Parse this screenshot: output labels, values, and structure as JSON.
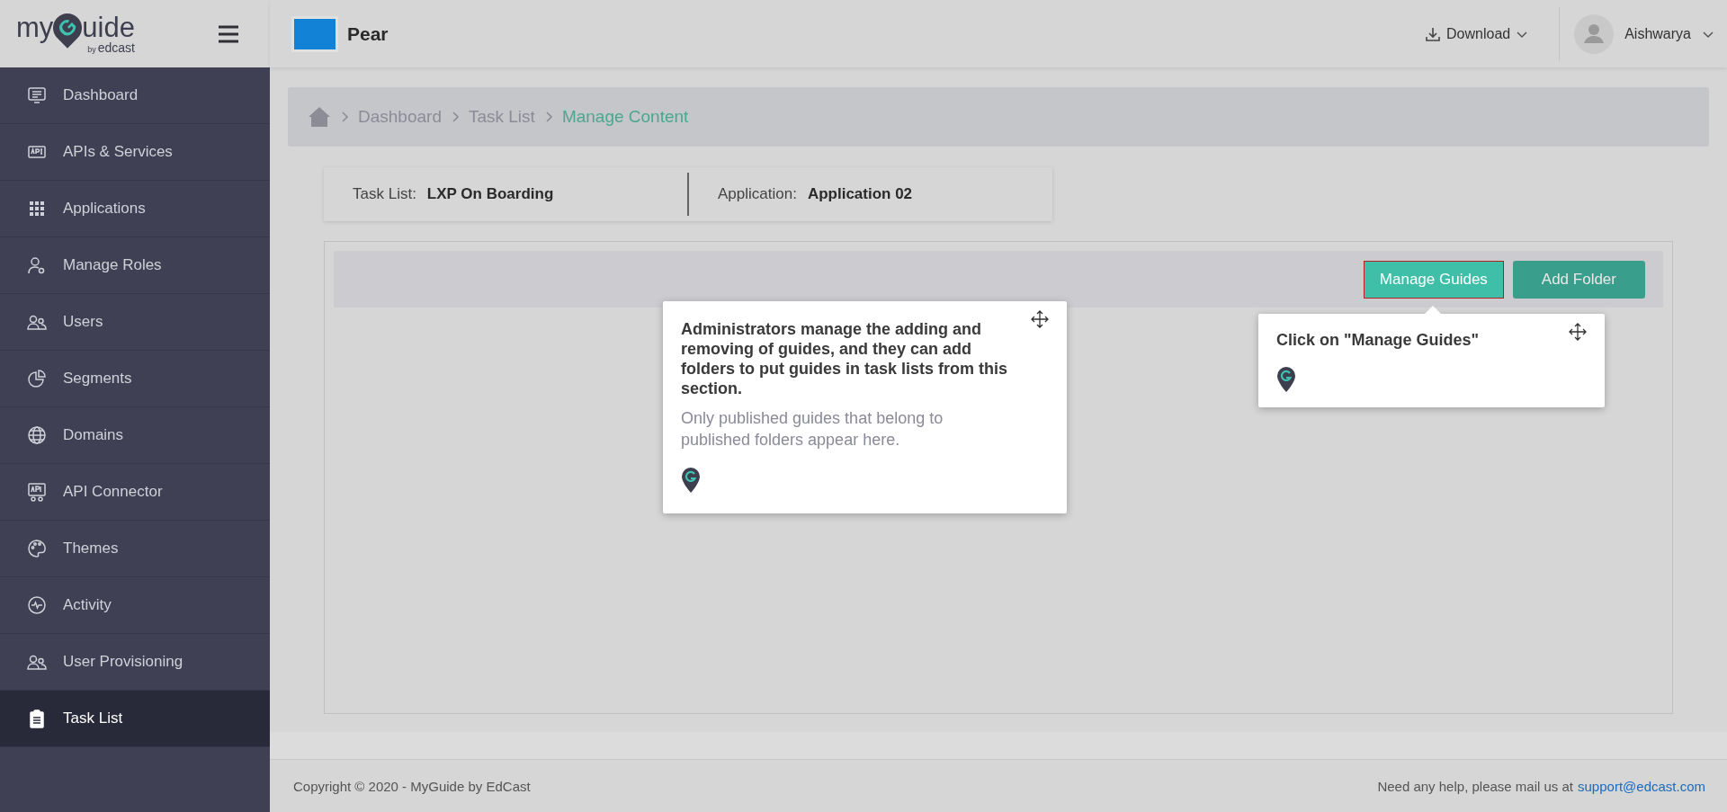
{
  "brand": {
    "prefix": "my",
    "mark": "G",
    "suffix": "uide",
    "byline": "by",
    "company": "edcast"
  },
  "header": {
    "app_name": "Pear",
    "download": "Download",
    "user": "Aishwarya"
  },
  "sidebar": {
    "items": [
      {
        "label": "Dashboard",
        "selected": false
      },
      {
        "label": "APIs & Services",
        "selected": false
      },
      {
        "label": "Applications",
        "selected": false
      },
      {
        "label": "Manage Roles",
        "selected": false
      },
      {
        "label": "Users",
        "selected": false
      },
      {
        "label": "Segments",
        "selected": false
      },
      {
        "label": "Domains",
        "selected": false
      },
      {
        "label": "API Connector",
        "selected": false
      },
      {
        "label": "Themes",
        "selected": false
      },
      {
        "label": "Activity",
        "selected": false
      },
      {
        "label": "User Provisioning",
        "selected": false
      },
      {
        "label": "Task List",
        "selected": true
      }
    ]
  },
  "breadcrumb": [
    {
      "label": "Dashboard",
      "current": false
    },
    {
      "label": "Task List",
      "current": false
    },
    {
      "label": "Manage Content",
      "current": true
    }
  ],
  "info": {
    "task_list_label": "Task List:",
    "task_list_value": "LXP On Boarding",
    "application_label": "Application:",
    "application_value": "Application 02"
  },
  "toolbar": {
    "buttons": [
      {
        "label": "Manage Guides",
        "highlighted": true
      },
      {
        "label": "Add Folder",
        "highlighted": false
      }
    ]
  },
  "tooltips": [
    {
      "title": "Administrators manage the adding and removing of guides, and they can add folders to put guides in task lists from this section.",
      "body": "Only published guides that belong to published folders appear here."
    },
    {
      "title": "Click on \"Manage Guides\""
    }
  ],
  "footer": {
    "copyright": "Copyright © 2020 - MyGuide by EdCast",
    "help": "Need any help, please mail us at",
    "email": "support@edcast.com"
  }
}
